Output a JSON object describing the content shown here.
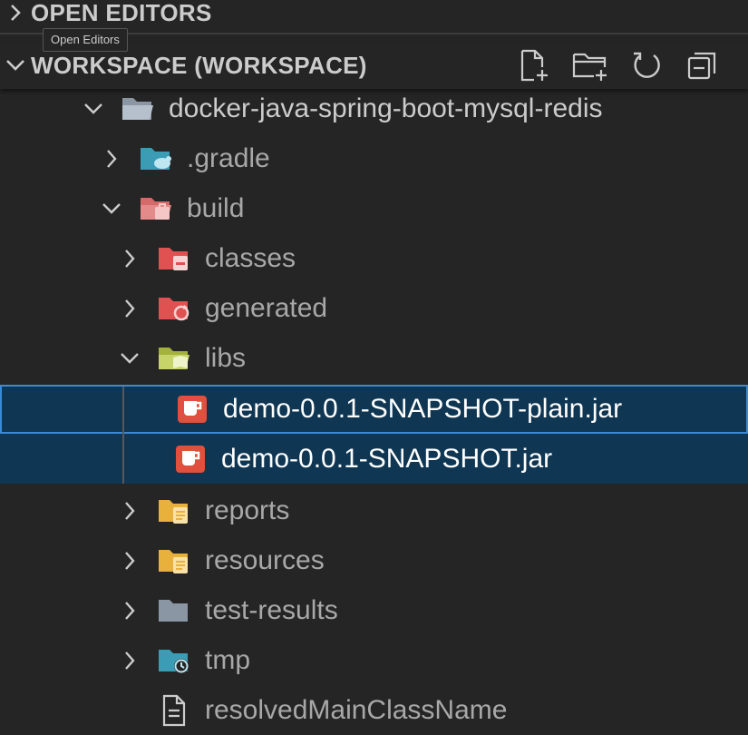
{
  "open_editors": {
    "title": "OPEN EDITORS",
    "tooltip": "Open Editors"
  },
  "workspace": {
    "title": "WORKSPACE (WORKSPACE)",
    "toolbar": {
      "new_file_icon": "new-file-icon",
      "new_folder_icon": "new-folder-icon",
      "refresh_icon": "refresh-icon",
      "collapse_icon": "collapse-all-icon"
    }
  },
  "tree": [
    {
      "label": "docker-java-spring-boot-mysql-redis",
      "expanded": true,
      "icon": "folder-open-icon"
    },
    {
      "label": ".gradle",
      "expanded": false,
      "icon": "gradle-folder-icon"
    },
    {
      "label": "build",
      "expanded": true,
      "icon": "build-folder-icon"
    },
    {
      "label": "classes",
      "expanded": false,
      "icon": "classes-folder-icon"
    },
    {
      "label": "generated",
      "expanded": false,
      "icon": "generated-folder-icon"
    },
    {
      "label": "libs",
      "expanded": true,
      "icon": "libs-folder-icon"
    },
    {
      "label": "demo-0.0.1-SNAPSHOT-plain.jar",
      "icon": "jar-file-icon"
    },
    {
      "label": "demo-0.0.1-SNAPSHOT.jar",
      "icon": "jar-file-icon"
    },
    {
      "label": "reports",
      "expanded": false,
      "icon": "reports-folder-icon"
    },
    {
      "label": "resources",
      "expanded": false,
      "icon": "resources-folder-icon"
    },
    {
      "label": "test-results",
      "expanded": false,
      "icon": "folder-icon"
    },
    {
      "label": "tmp",
      "expanded": false,
      "icon": "tmp-folder-icon"
    },
    {
      "label": "resolvedMainClassName",
      "icon": "file-icon"
    }
  ]
}
